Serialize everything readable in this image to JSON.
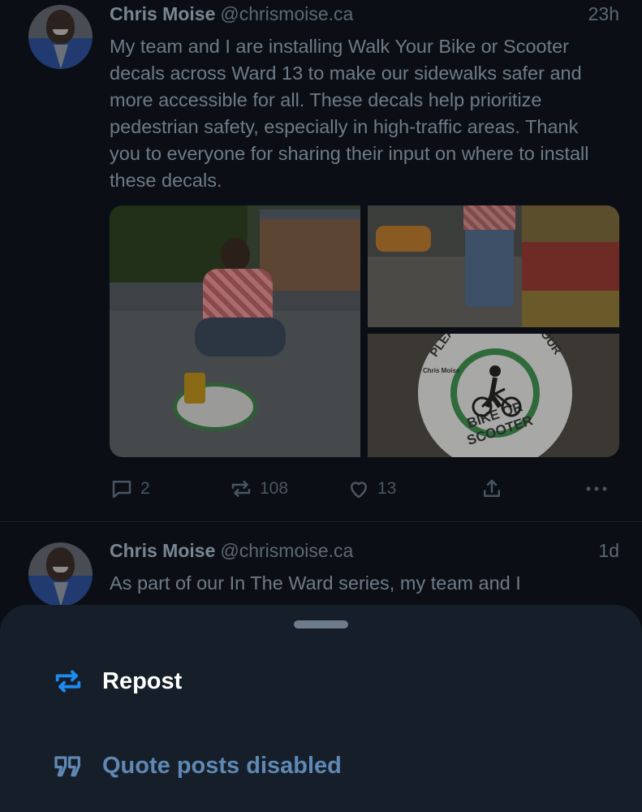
{
  "posts": [
    {
      "author": "Chris Moise",
      "handle": "@chrismoise.ca",
      "time": "23h",
      "text": "My team and I are installing Walk Your Bike or Scooter decals across Ward 13 to make our sidewalks safer and more accessible for all. These decals help prioritize pedestrian safety, especially in high-traffic areas. Thank you to everyone for sharing their input on where to install these decals.",
      "images": {
        "decal_top_left": "PLEA",
        "decal_top_right": "OUR",
        "decal_bottom": "BIKE OR SCOOTER",
        "decal_brand": "Chris Moise",
        "decal1_text": "PLEASE W"
      },
      "stats": {
        "replies": "2",
        "reposts": "108",
        "likes": "13"
      }
    },
    {
      "author": "Chris Moise",
      "handle": "@chrismoise.ca",
      "time": "1d",
      "text": "As part of our In The Ward series, my team and I"
    }
  ],
  "sheet": {
    "repost_label": "Repost",
    "quote_label": "Quote posts disabled"
  },
  "colors": {
    "background": "#0b0f15",
    "sheet": "#161f29",
    "accent_blue": "#1d8cf0",
    "disabled_blue": "#5f88b4"
  },
  "icons": {
    "reply": "speech-bubble-icon",
    "repost": "repost-arrows-icon",
    "like": "heart-icon",
    "share": "share-icon",
    "more": "ellipsis-icon",
    "quote": "quote-icon"
  }
}
